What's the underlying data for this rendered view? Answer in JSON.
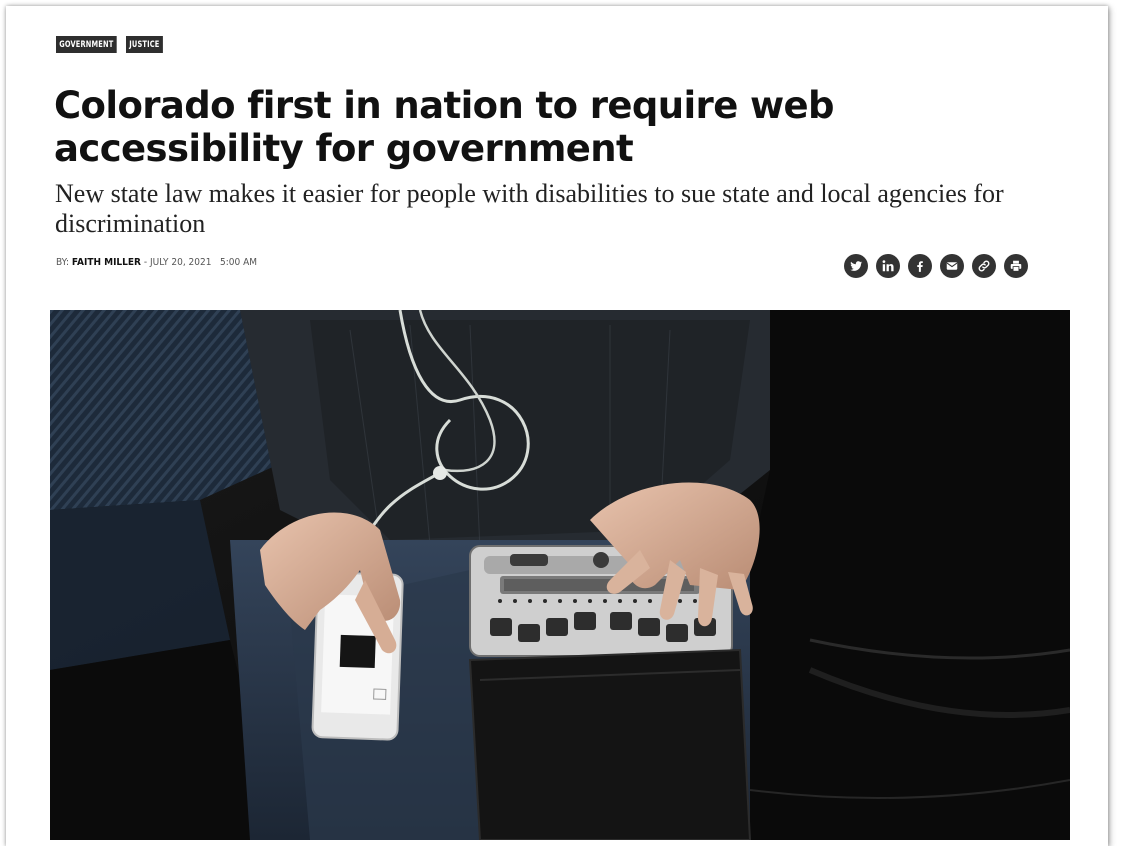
{
  "article": {
    "tags": [
      "GOVERNMENT",
      "JUSTICE"
    ],
    "title": "Colorado first in nation to require web accessibility for government",
    "subtitle": "New state law makes it easier for people with disabilities to sue state and local agencies for discrimination",
    "byline": {
      "prefix": "BY: ",
      "author": "FAITH MILLER",
      "separator": " - ",
      "date": "JULY 20, 2021",
      "time": "5:00 AM"
    }
  },
  "share": {
    "icons": [
      "twitter-icon",
      "linkedin-icon",
      "facebook-icon",
      "email-icon",
      "link-icon",
      "print-icon"
    ]
  },
  "hero_image": {
    "description_icon": "photo-braille-display-and-phone"
  },
  "colors": {
    "tag_bg": "#2e2e2e",
    "share_bg": "#333333",
    "title": "#111111"
  }
}
